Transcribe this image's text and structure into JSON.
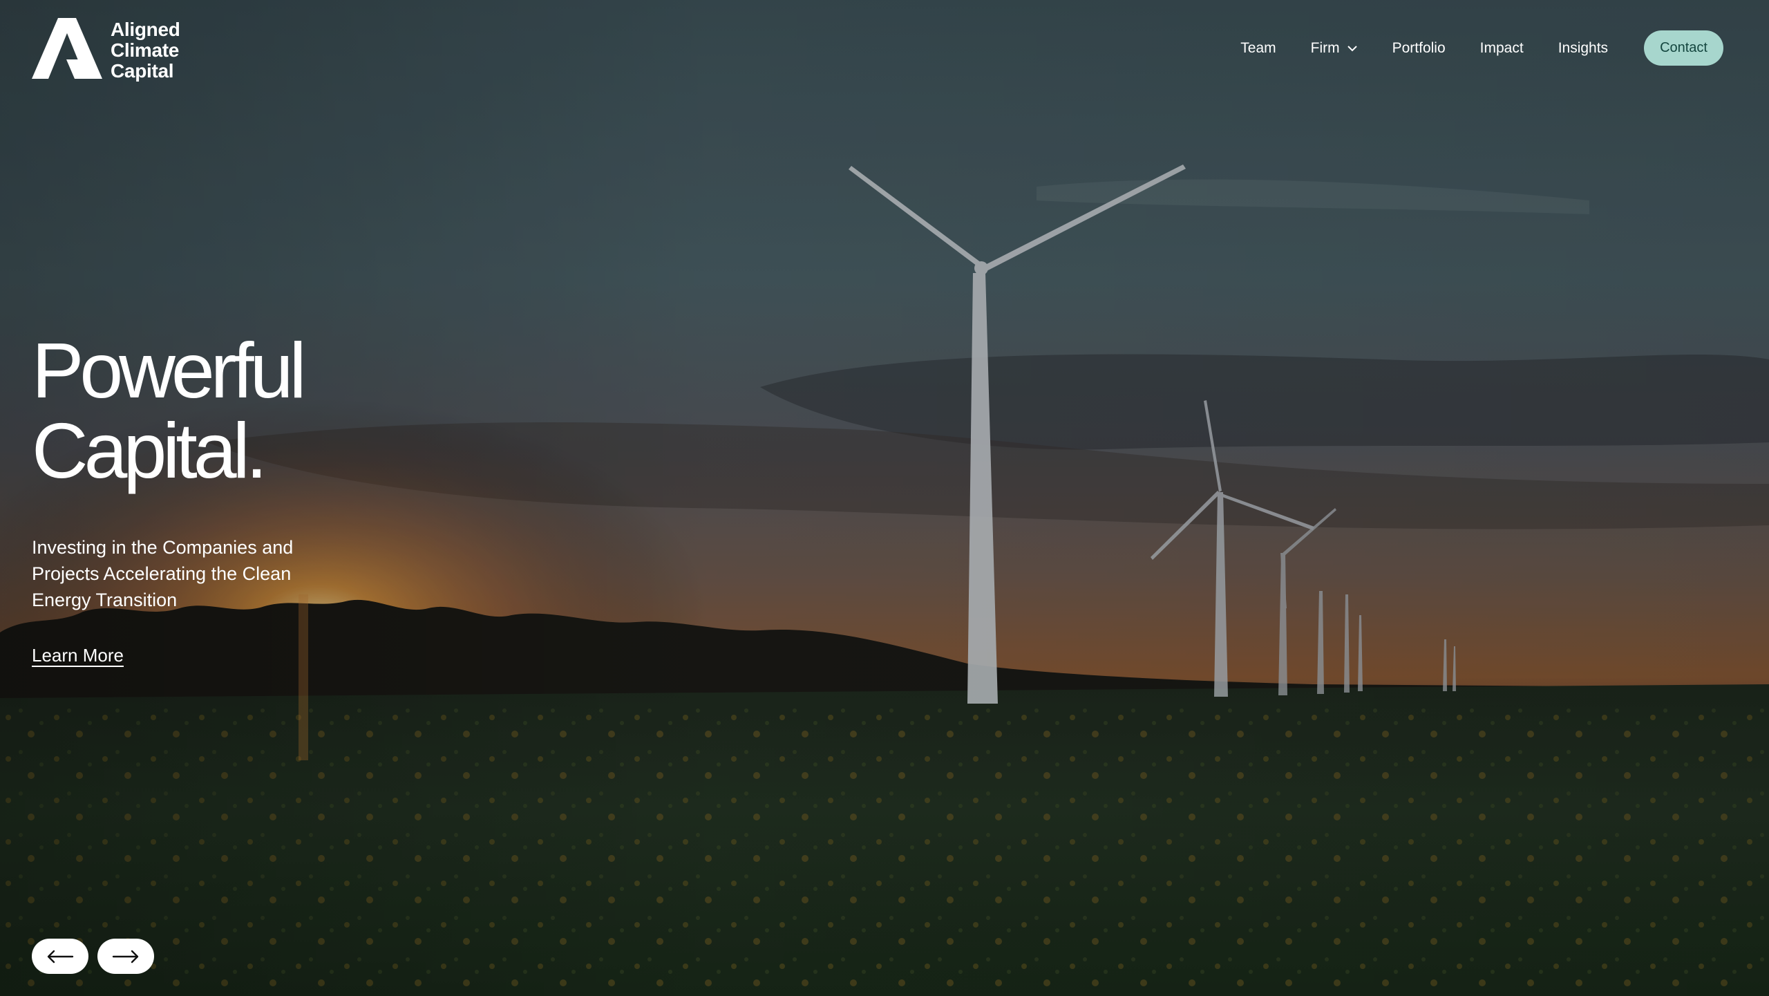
{
  "brand": {
    "name_line1": "Aligned",
    "name_line2": "Climate",
    "name_line3": "Capital",
    "accent": "#a7d6cd",
    "accent_text": "#14463f"
  },
  "nav": {
    "items": [
      {
        "label": "Team"
      },
      {
        "label": "Firm",
        "has_dropdown": true
      },
      {
        "label": "Portfolio"
      },
      {
        "label": "Impact"
      },
      {
        "label": "Insights"
      }
    ],
    "contact_label": "Contact"
  },
  "hero": {
    "headline_line1": "Powerful",
    "headline_line2": "Capital.",
    "subheadline": "Investing in the Companies and Projects Accelerating the Clean Energy Transition",
    "cta_label": "Learn More",
    "background": "wind-turbines-sunflower-field-sunset"
  },
  "slider": {
    "prev_icon": "arrow-left-icon",
    "next_icon": "arrow-right-icon"
  }
}
